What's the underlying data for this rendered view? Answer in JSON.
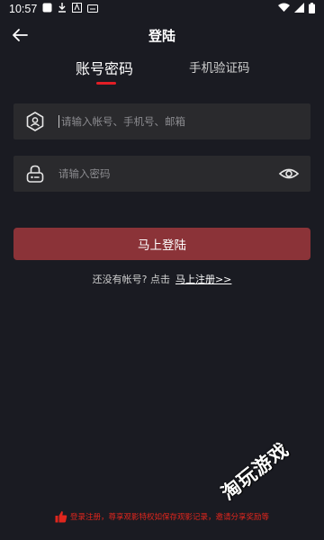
{
  "status": {
    "time": "10:57"
  },
  "header": {
    "title": "登陆"
  },
  "tabs": [
    {
      "label": "账号密码",
      "active": true
    },
    {
      "label": "手机验证码",
      "active": false
    }
  ],
  "form": {
    "username_placeholder": "请输入帐号、手机号、邮箱",
    "password_placeholder": "请输入密码",
    "login_label": "马上登陆"
  },
  "register": {
    "prompt": "还没有帐号? 点击",
    "link": "马上注册>>"
  },
  "watermark": "淘玩游戏",
  "footer": {
    "note": "登录注册，尊享观影特权如保存观影记录，邀请分享奖励等"
  },
  "colors": {
    "accent": "#e21e26",
    "button": "#8b3338",
    "background": "#1a1b22"
  }
}
